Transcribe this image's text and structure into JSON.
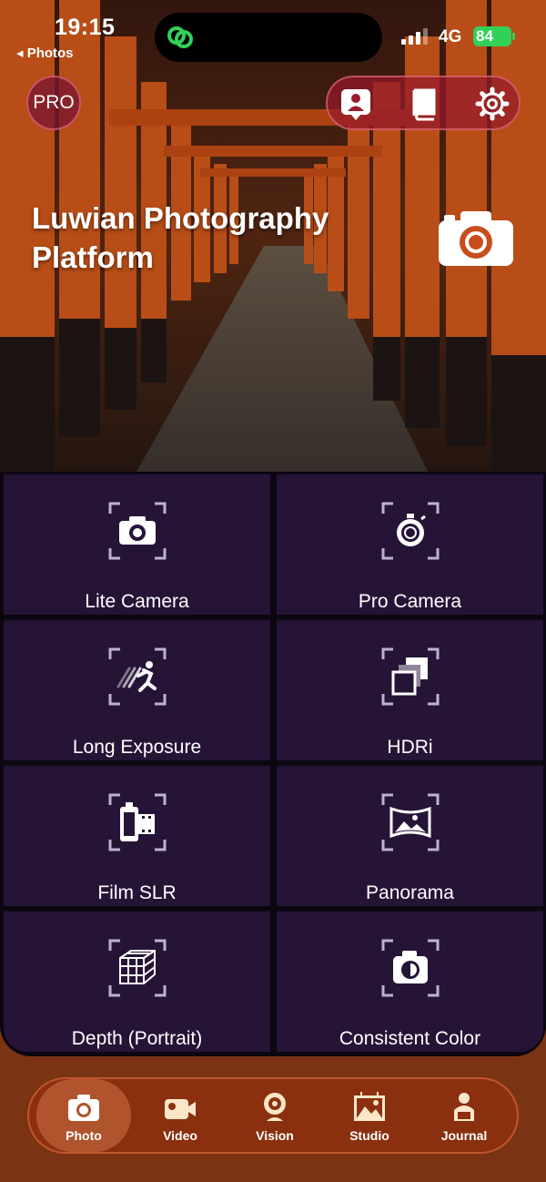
{
  "status_bar": {
    "time": "19:15",
    "back_label": "◂ Photos",
    "network": "4G",
    "battery": "84"
  },
  "header": {
    "pro_label": "PRO",
    "title": "Luwian Photography Platform"
  },
  "top_actions": [
    "profile-icon",
    "book-icon",
    "gear-icon"
  ],
  "modes": [
    {
      "label": "Lite Camera",
      "icon": "lite-camera-icon"
    },
    {
      "label": "Pro Camera",
      "icon": "pro-camera-icon"
    },
    {
      "label": "Long Exposure",
      "icon": "long-exposure-icon"
    },
    {
      "label": "HDRi",
      "icon": "hdri-icon"
    },
    {
      "label": "Film SLR",
      "icon": "film-roll-icon"
    },
    {
      "label": "Panorama",
      "icon": "panorama-icon"
    },
    {
      "label": "Depth (Portrait)",
      "icon": "depth-cube-icon"
    },
    {
      "label": "Consistent Color",
      "icon": "color-camera-icon"
    }
  ],
  "tabs": [
    {
      "label": "Photo",
      "icon": "photo-camera-icon",
      "active": true
    },
    {
      "label": "Video",
      "icon": "video-camera-icon",
      "active": false
    },
    {
      "label": "Vision",
      "icon": "webcam-icon",
      "active": false
    },
    {
      "label": "Studio",
      "icon": "studio-easel-icon",
      "active": false
    },
    {
      "label": "Journal",
      "icon": "journal-icon",
      "active": false
    }
  ],
  "colors": {
    "tile_bg": "#261437",
    "accent": "#b0542e",
    "battery": "#31d158"
  }
}
